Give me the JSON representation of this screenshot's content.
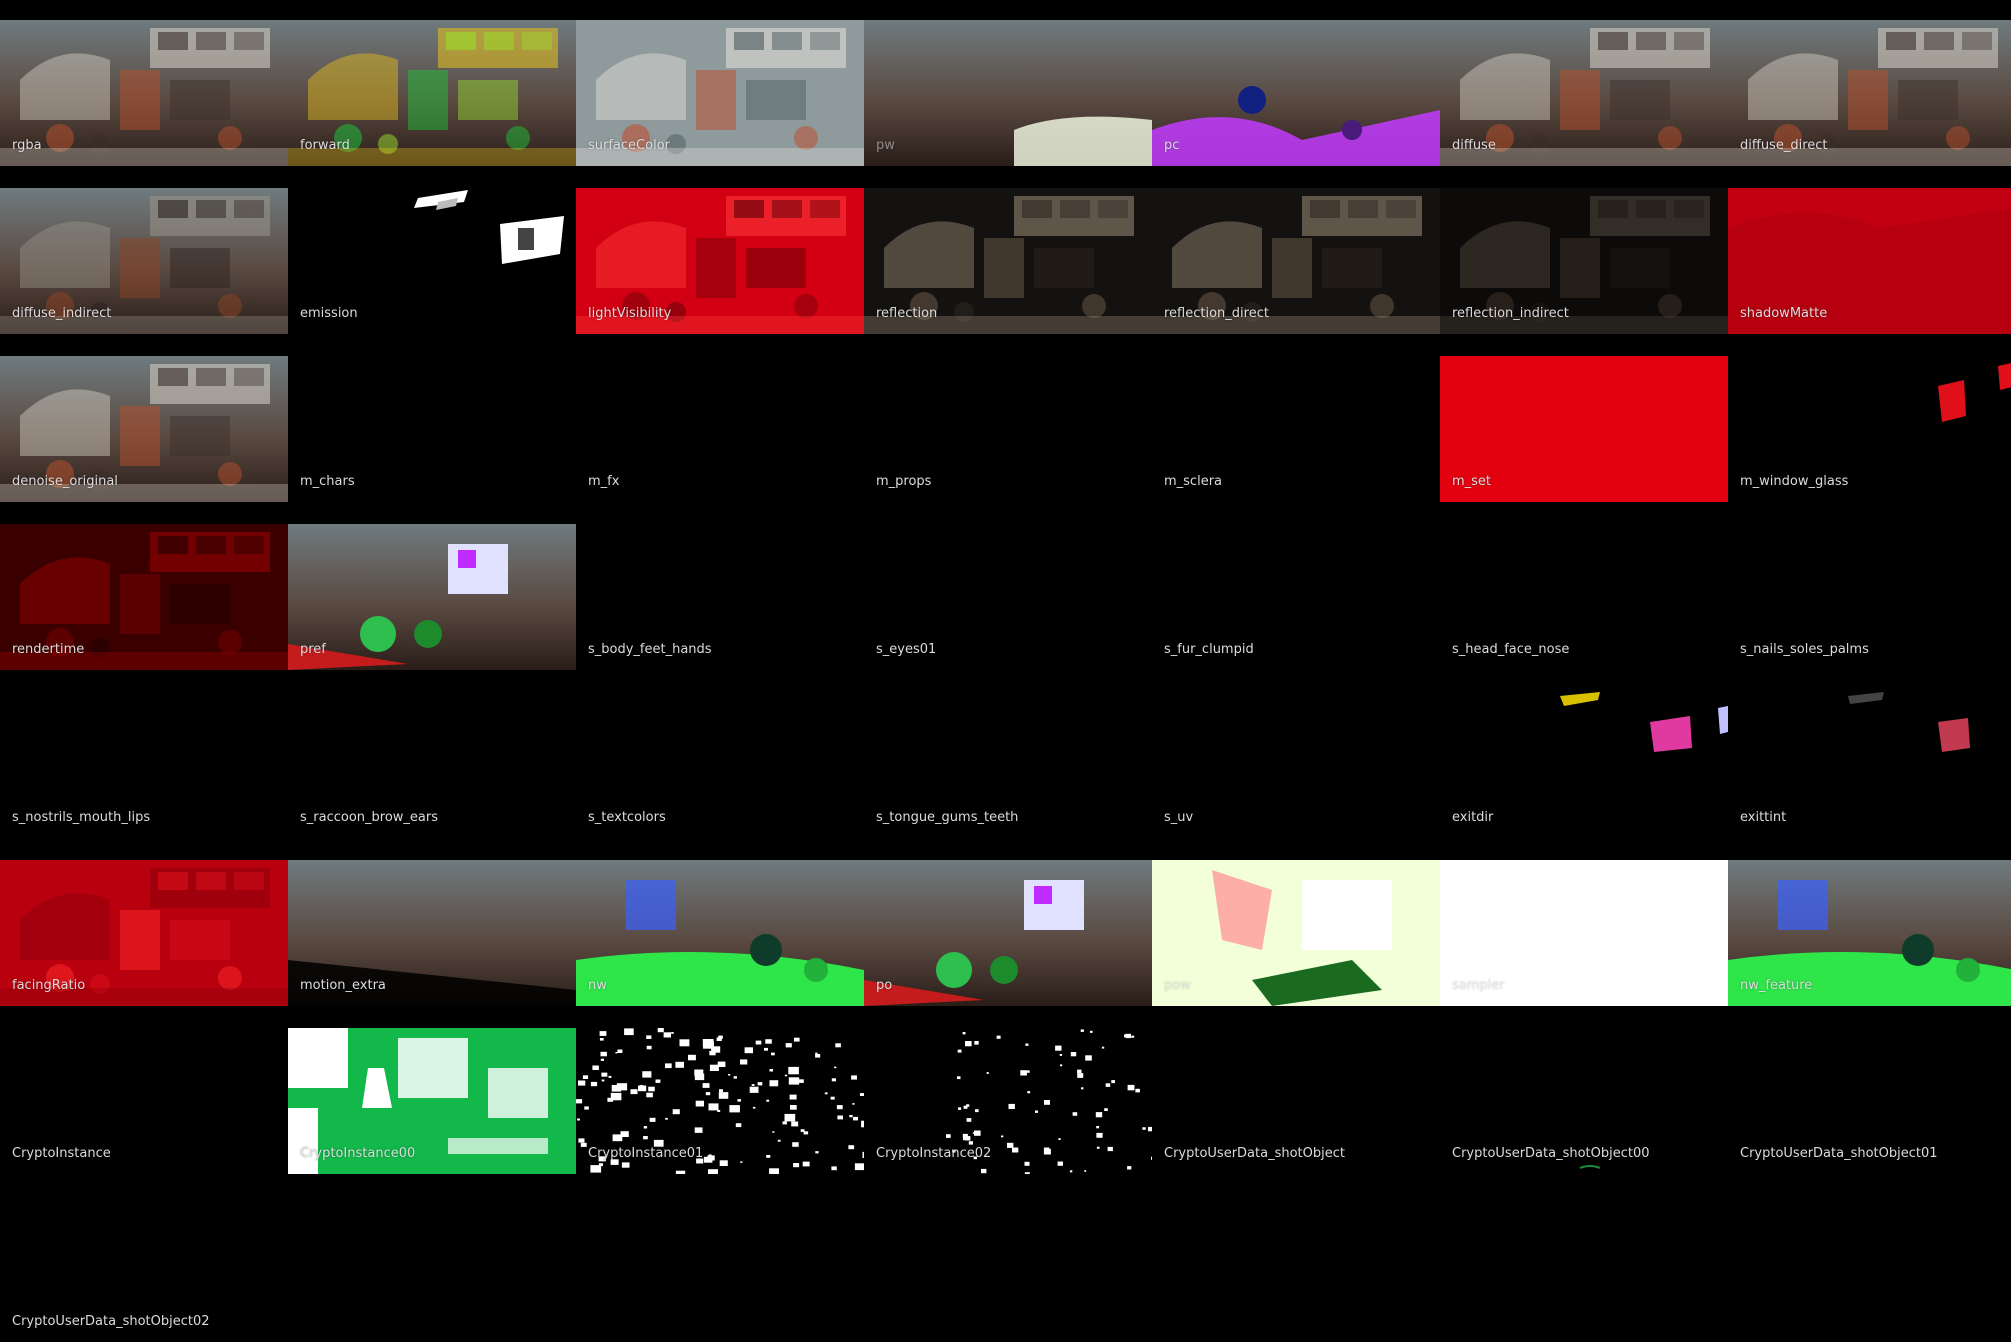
{
  "contact_sheet": {
    "layers": [
      {
        "name": "rgba",
        "look": "beauty"
      },
      {
        "name": "forward",
        "look": "forward"
      },
      {
        "name": "surfaceColor",
        "look": "albedo"
      },
      {
        "name": "pw",
        "look": "pw"
      },
      {
        "name": "pc",
        "look": "pc"
      },
      {
        "name": "diffuse",
        "look": "beauty"
      },
      {
        "name": "diffuse_direct",
        "look": "beauty"
      },
      {
        "name": "diffuse_indirect",
        "look": "beauty_dark"
      },
      {
        "name": "emission",
        "look": "emission"
      },
      {
        "name": "lightVisibility",
        "look": "red_scene"
      },
      {
        "name": "reflection",
        "look": "reflection"
      },
      {
        "name": "reflection_direct",
        "look": "reflection"
      },
      {
        "name": "reflection_indirect",
        "look": "reflection_dark"
      },
      {
        "name": "shadowMatte",
        "look": "red_flat"
      },
      {
        "name": "denoise_original",
        "look": "beauty"
      },
      {
        "name": "m_chars",
        "look": "black"
      },
      {
        "name": "m_fx",
        "look": "black"
      },
      {
        "name": "m_props",
        "look": "black"
      },
      {
        "name": "m_sclera",
        "look": "black"
      },
      {
        "name": "m_set",
        "look": "red_solid"
      },
      {
        "name": "m_window_glass",
        "look": "window_glass"
      },
      {
        "name": "rendertime",
        "look": "rendertime"
      },
      {
        "name": "pref",
        "look": "pref"
      },
      {
        "name": "s_body_feet_hands",
        "look": "black"
      },
      {
        "name": "s_eyes01",
        "look": "black"
      },
      {
        "name": "s_fur_clumpid",
        "look": "black"
      },
      {
        "name": "s_head_face_nose",
        "look": "black"
      },
      {
        "name": "s_nails_soles_palms",
        "look": "black"
      },
      {
        "name": "s_nostrils_mouth_lips",
        "look": "black"
      },
      {
        "name": "s_raccoon_brow_ears",
        "look": "black"
      },
      {
        "name": "s_textcolors",
        "look": "black"
      },
      {
        "name": "s_tongue_gums_teeth",
        "look": "black"
      },
      {
        "name": "s_uv",
        "look": "black"
      },
      {
        "name": "exitdir",
        "look": "exitdir"
      },
      {
        "name": "exittint",
        "look": "exittint"
      },
      {
        "name": "facingRatio",
        "look": "facing"
      },
      {
        "name": "motion_extra",
        "look": "motion"
      },
      {
        "name": "nw",
        "look": "normals"
      },
      {
        "name": "po",
        "look": "pref"
      },
      {
        "name": "pow",
        "look": "pow"
      },
      {
        "name": "sampler",
        "look": "white"
      },
      {
        "name": "nw_feature",
        "look": "normals"
      },
      {
        "name": "CryptoInstance",
        "look": "black"
      },
      {
        "name": "CryptoInstance00",
        "look": "crypto_green"
      },
      {
        "name": "CryptoInstance01",
        "look": "crypto_white"
      },
      {
        "name": "CryptoInstance02",
        "look": "crypto_sparse"
      },
      {
        "name": "CryptoUserData_shotObject",
        "look": "black"
      },
      {
        "name": "CryptoUserData_shotObject00",
        "look": "black_hint"
      },
      {
        "name": "CryptoUserData_shotObject01",
        "look": "black"
      },
      {
        "name": "CryptoUserData_shotObject02",
        "look": "black"
      }
    ],
    "dim_labels": [
      "pw",
      "pow",
      "sampler"
    ]
  }
}
